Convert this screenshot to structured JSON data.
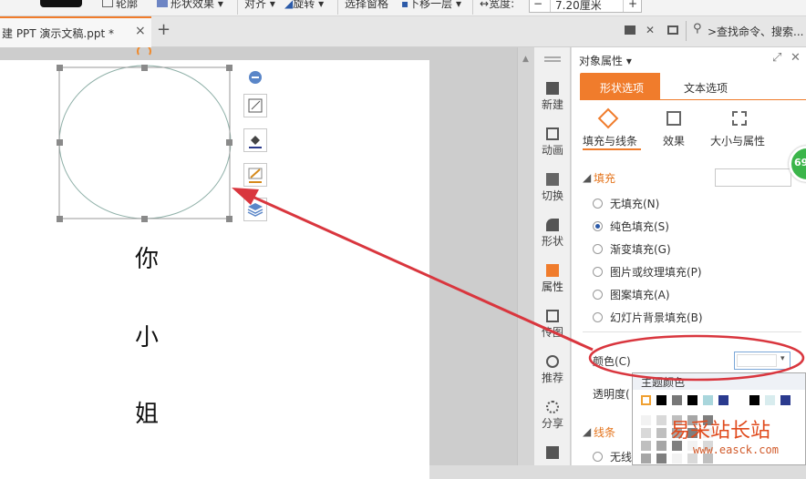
{
  "toolbar": {
    "outline_label": "轮廓",
    "shape_effects_label": "形状效果",
    "align_label": "对齐",
    "rotate_label": "旋转",
    "selection_pane_label": "选择窗格",
    "send_backward_label": "下移一层",
    "width_label": "宽度:",
    "width_value": "7.20厘米",
    "minus": "−",
    "plus": "+"
  },
  "tabbar": {
    "doc_tab_label": "建 PPT 演示文稿.ppt *",
    "close_glyph": "×",
    "new_tab_glyph": "+",
    "search_label": ">查找命令、搜索..."
  },
  "slide": {
    "chars": [
      "你",
      "小",
      "姐"
    ]
  },
  "sidebar": {
    "items": [
      {
        "label": "新建",
        "icon": "document-icon"
      },
      {
        "label": "动画",
        "icon": "animation-icon"
      },
      {
        "label": "切换",
        "icon": "transition-icon"
      },
      {
        "label": "形状",
        "icon": "shape-icon"
      },
      {
        "label": "属性",
        "icon": "properties-icon"
      },
      {
        "label": "传图",
        "icon": "image-upload-icon"
      },
      {
        "label": "推荐",
        "icon": "recommend-icon"
      },
      {
        "label": "分享",
        "icon": "share-icon"
      },
      {
        "label": "",
        "icon": "briefcase-icon"
      }
    ]
  },
  "panel": {
    "title": "对象属性",
    "tabs": [
      "形状选项",
      "文本选项"
    ],
    "subtabs": [
      "填充与线条",
      "效果",
      "大小与属性"
    ],
    "fill_section": "填充",
    "fill_options": [
      {
        "label": "无填充(N)",
        "selected": false
      },
      {
        "label": "纯色填充(S)",
        "selected": true
      },
      {
        "label": "渐变填充(G)",
        "selected": false
      },
      {
        "label": "图片或纹理填充(P)",
        "selected": false
      },
      {
        "label": "图案填充(A)",
        "selected": false
      },
      {
        "label": "幻灯片背景填充(B)",
        "selected": false
      }
    ],
    "color_label": "颜色(C)",
    "transparency_label": "透明度(",
    "line_section": "线条",
    "no_line_label": "无线",
    "badge_text": "69"
  },
  "popup": {
    "theme_colors_label": "主题颜色"
  },
  "watermark": {
    "text": "易采站长站",
    "url": "www.easck.com"
  },
  "colors": {
    "accent_orange": "#f07c2c",
    "annotation_red": "#d9363e",
    "selected_blue": "#2b5aa8"
  }
}
